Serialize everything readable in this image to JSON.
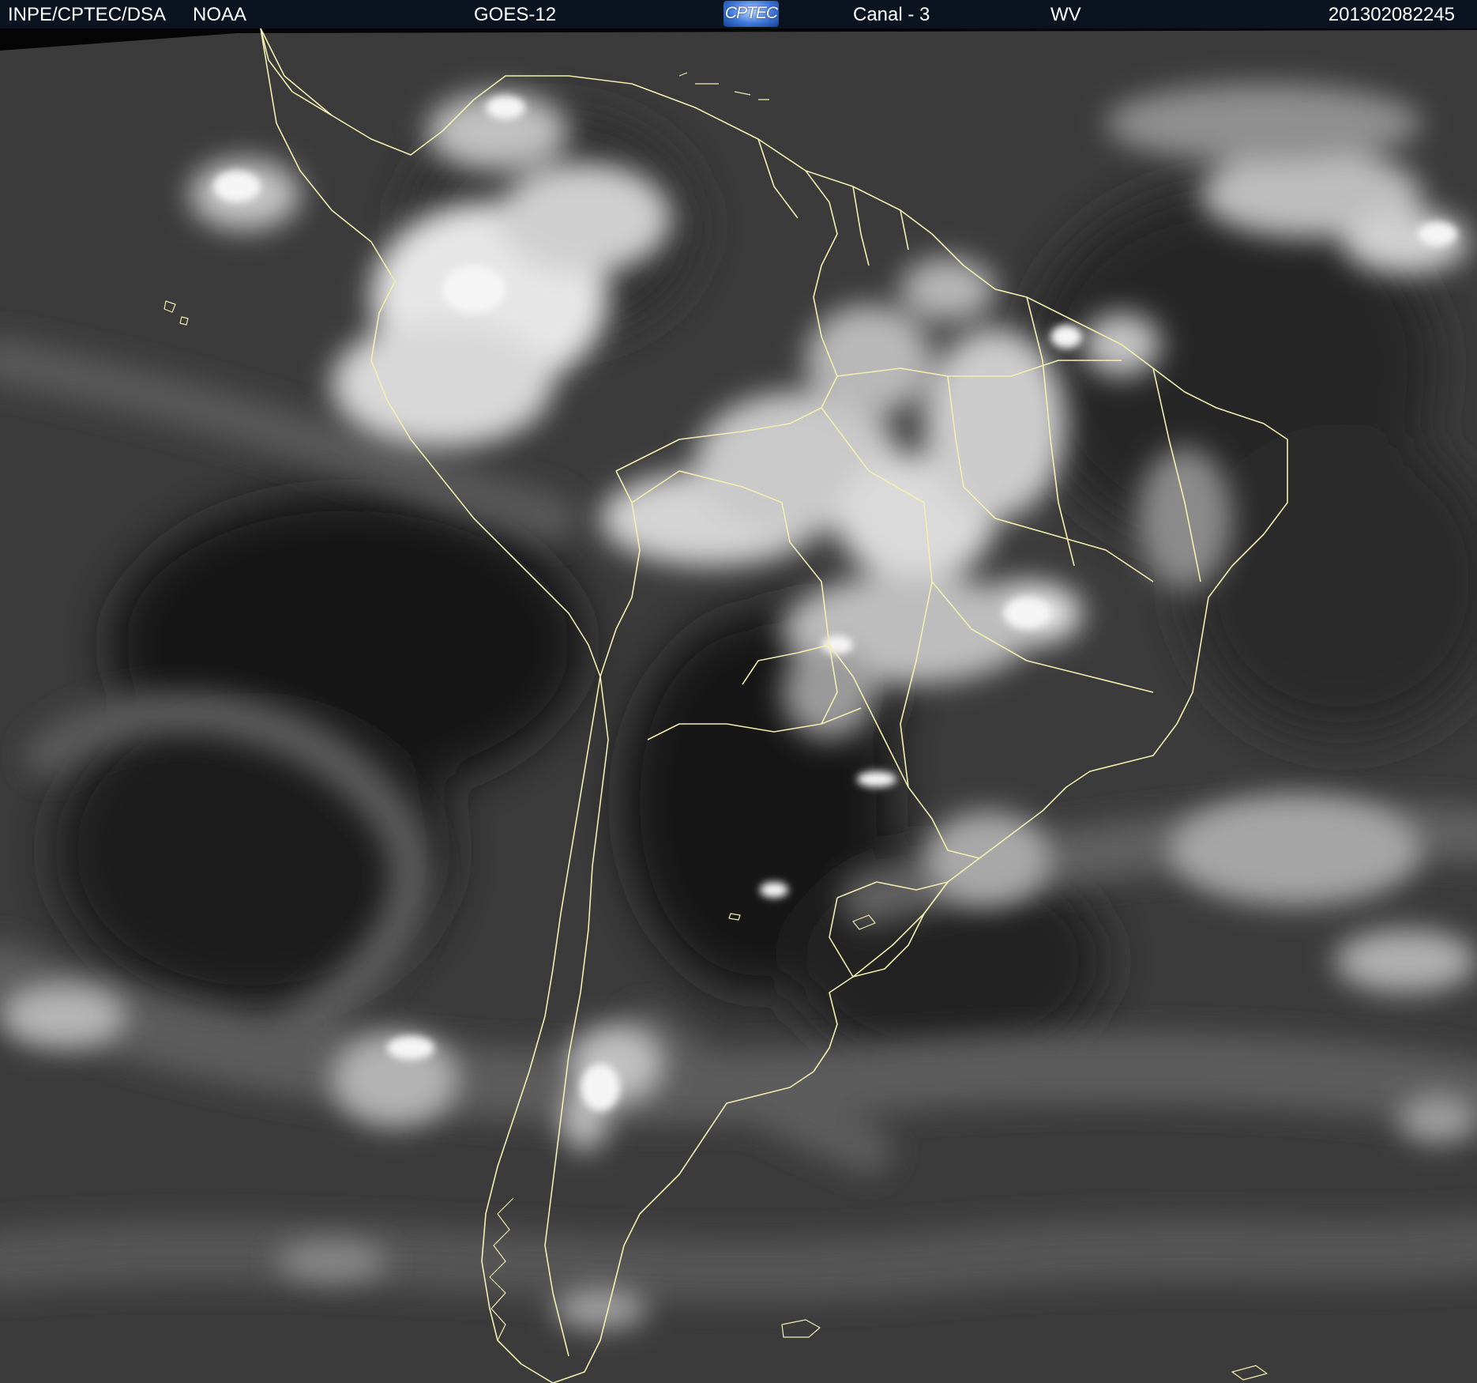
{
  "header": {
    "organization": "INPE/CPTEC/DSA",
    "agency": "NOAA",
    "satellite": "GOES-12",
    "logo_text": "CPTEC",
    "channel": "Canal - 3",
    "band": "WV",
    "timestamp": "201302082245"
  },
  "map": {
    "region": "South America",
    "imagery": "water-vapor grayscale",
    "coastline_color": "#f2efb0",
    "background_color": "#3a3a3a"
  }
}
